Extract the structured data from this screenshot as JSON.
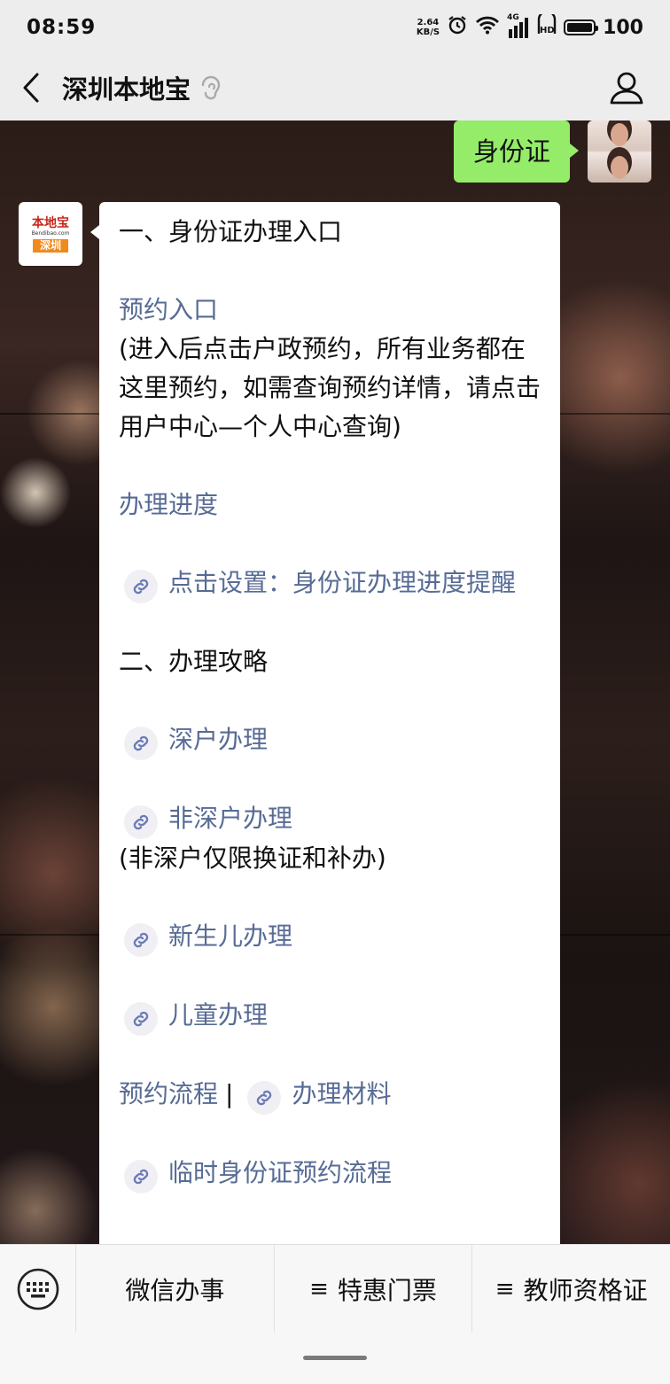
{
  "status_bar": {
    "time": "08:59",
    "net_speed_value": "2.64",
    "net_speed_unit": "KB/S",
    "network_type": "4G",
    "battery_level": "100"
  },
  "nav": {
    "title": "深圳本地宝"
  },
  "messages": {
    "user_text": "身份证",
    "bot_avatar": {
      "brand": "本地宝",
      "url": "Bendibao.com",
      "city": "深圳"
    },
    "bot_reply": {
      "heading_1": "一、身份证办理入口",
      "appointment_link": "预约入口",
      "appointment_note": "(进入后点击户政预约，所有业务都在这里预约，如需查询预约详情，请点击用户中心—个人中心查询)",
      "progress_link": "办理进度",
      "reminder_link": "点击设置：身份证办理进度提醒",
      "heading_2": "二、办理攻略",
      "shenzhen_hukou_link": "深户办理",
      "non_shenzhen_link": "非深户办理",
      "non_shenzhen_note": "(非深户仅限换证和补办)",
      "newborn_link": "新生儿办理",
      "child_link": "儿童办理",
      "process_link": "预约流程",
      "separator": "|",
      "materials_link": "办理材料",
      "temp_id_link": "临时身份证预约流程"
    }
  },
  "bottom_menu": {
    "item_1": "微信办事",
    "item_2": "特惠门票",
    "item_3": "教师资格证",
    "submenu_glyph": "≡"
  },
  "colors": {
    "user_bubble": "#95ec69",
    "link": "#576b95",
    "chrome_bg": "#ededed"
  },
  "icons": [
    "back-arrow-icon",
    "ear-icon",
    "profile-icon",
    "mini-program-link-icon",
    "keyboard-icon",
    "alarm-icon",
    "wifi-icon",
    "signal-icon",
    "hd-icon",
    "battery-icon"
  ]
}
